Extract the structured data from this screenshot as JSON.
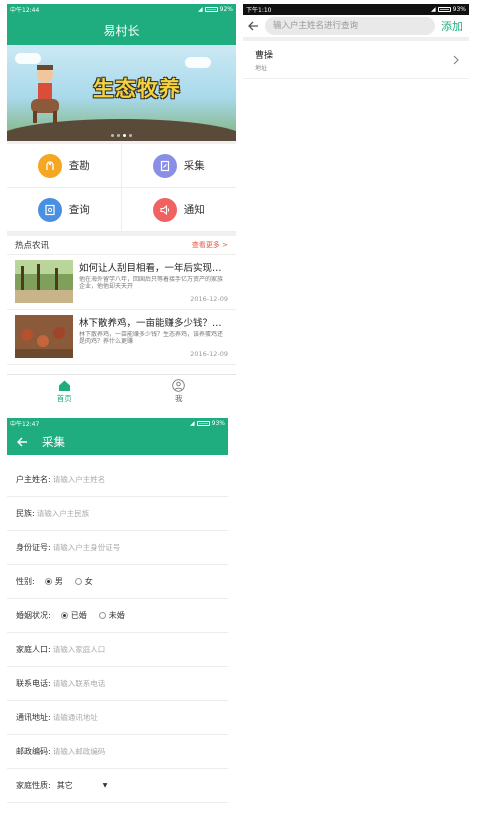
{
  "home": {
    "status": {
      "time": "中午12:44",
      "battery": "92%"
    },
    "title": "易村长",
    "banner": {
      "headline": "生态牧养"
    },
    "quick_actions": [
      {
        "label": "查勘",
        "icon": "survey-icon",
        "color": "#f5a623"
      },
      {
        "label": "采集",
        "icon": "collect-icon",
        "color": "#8a8fe6"
      },
      {
        "label": "查询",
        "icon": "query-icon",
        "color": "#4a90e2"
      },
      {
        "label": "通知",
        "icon": "notify-icon",
        "color": "#f06262"
      }
    ],
    "news": {
      "section_title": "热点农讯",
      "more_label": "查看更多 >",
      "items": [
        {
          "title": "如何让人刮目相看，一年后实现年...",
          "desc": "他在海外留学八年，回国后只等着接手亿万资产的家族企业，他他却天天开",
          "date": "2016-12-09"
        },
        {
          "title": "林下散养鸡，一亩能赚多少钱？生...",
          "desc": "林下散养鸡，一亩能赚多少钱？生态养鸡，该养蛋鸡还是肉鸡？养什么更赚",
          "date": "2016-12-09"
        }
      ]
    },
    "tabs": [
      {
        "label": "首页",
        "icon": "home-icon"
      },
      {
        "label": "我",
        "icon": "user-icon"
      }
    ]
  },
  "search": {
    "status": {
      "time": "下午1:10",
      "battery": "93%"
    },
    "placeholder": "输入户主姓名进行查询",
    "add_label": "添加",
    "results": [
      {
        "name": "曹操",
        "sub": "地址"
      }
    ]
  },
  "form": {
    "status": {
      "time": "中午12:47",
      "battery": "93%"
    },
    "title": "采集",
    "fields": {
      "owner_name": {
        "label": "户主姓名:",
        "placeholder": "请输入户主姓名"
      },
      "ethnicity": {
        "label": "民族:",
        "placeholder": "请输入户主民族"
      },
      "id_number": {
        "label": "身份证号:",
        "placeholder": "请输入户主身份证号"
      },
      "gender": {
        "label": "性别:",
        "options": [
          "男",
          "女"
        ],
        "selected": "男"
      },
      "marital": {
        "label": "婚姻状况:",
        "options": [
          "已婚",
          "未婚"
        ],
        "selected": "已婚"
      },
      "household_size": {
        "label": "家庭人口:",
        "placeholder": "请输入家庭人口"
      },
      "phone": {
        "label": "联系电话:",
        "placeholder": "请输入联系电话"
      },
      "address": {
        "label": "通讯地址:",
        "placeholder": "请输通讯地址"
      },
      "postcode": {
        "label": "邮政编码:",
        "placeholder": "请输入邮政编码"
      },
      "family_type": {
        "label": "家庭性质:",
        "value": "其它"
      }
    }
  }
}
